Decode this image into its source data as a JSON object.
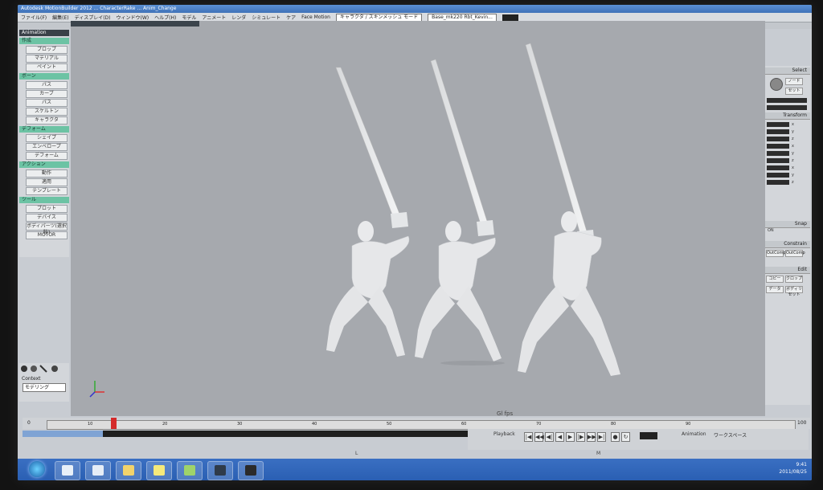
{
  "window": {
    "title": "Autodesk MotionBuilder 2012 ... CharacterRake ... Anim_Change",
    "menu": [
      "ファイル(F)",
      "編集(E)",
      "ディスプレイ(D)",
      "ウィンドウ(W)",
      "ヘルプ(H)",
      "モデル",
      "アニメート",
      "レンダ",
      "シミュレート",
      "ケア",
      "Face Motion"
    ],
    "menu_combo": "キャラクタ / スキンメッシュ モード",
    "file_combo": "Base_mk220 Rbt_Kevin..."
  },
  "left_panel": {
    "header": "Animation",
    "sections": [
      {
        "title": "作成",
        "items": [
          "プロップ",
          "マテリアル",
          "ペイント"
        ]
      },
      {
        "title": "ボーン",
        "items": [
          "パス",
          "カーブ",
          "パス",
          "スケルトン",
          "キャラクタ"
        ]
      },
      {
        "title": "デフォーム",
        "items": [
          "シェイプ",
          "エンベロープ",
          "デフォーム"
        ]
      },
      {
        "title": "アクション",
        "items": [
          "動作",
          "適用",
          "テンプレート"
        ]
      },
      {
        "title": "ツール",
        "items": [
          "プロット",
          "デバイス",
          "ボディパーツ(選択肢)",
          "MOTOR"
        ]
      }
    ],
    "context_label": "Context",
    "context_value": "モデリング"
  },
  "viewport": {
    "label": "Gl fps"
  },
  "right_panel": {
    "select_header": "Select",
    "select_buttons": [
      "ノード",
      "セット"
    ],
    "transform_header": "Transform",
    "axes": [
      "x",
      "y",
      "z",
      "x",
      "y",
      "z",
      "x",
      "y",
      "z"
    ],
    "snap_header": "Snap",
    "snap_value": "ON",
    "constrain_header": "Constrain",
    "constrain_buttons": [
      "OutComp",
      "OutComp"
    ],
    "edit_header": "Edit",
    "edit_buttons": [
      "コピー",
      "クロップ",
      "データ",
      "ボディリセット"
    ]
  },
  "timeline": {
    "start": "0",
    "end": "100",
    "ticks": [
      "10",
      "20",
      "30",
      "40",
      "50",
      "60",
      "70",
      "80",
      "90"
    ]
  },
  "playback": {
    "label": "Playback",
    "buttons": [
      "|◀",
      "◀◀",
      "◀|",
      "◀",
      "▶",
      "|▶",
      "▶▶",
      "▶|",
      "●",
      "↻"
    ],
    "animation_label": "Animation",
    "animation_value": "ワークスペース"
  },
  "status": {
    "left": "L",
    "middle": "M"
  },
  "taskbar": {
    "apps": [
      {
        "name": "media-player-icon",
        "color": "#e8f0f8"
      },
      {
        "name": "ie-icon",
        "color": "#e6edf6"
      },
      {
        "name": "folder-icon",
        "color": "#f2d36b"
      },
      {
        "name": "notes-icon",
        "color": "#f6ea7a"
      },
      {
        "name": "explorer-icon",
        "color": "#9fd36a"
      },
      {
        "name": "motionbuilder-icon",
        "color": "#2f3b4a"
      },
      {
        "name": "figure-icon",
        "color": "#2b2b2b"
      }
    ],
    "time": "9:41",
    "date": "2011/08/25"
  },
  "colors": {
    "section": "#6cc3a4",
    "viewport_bg": "#a6a9ae",
    "taskbar": "#2a5fb3"
  }
}
